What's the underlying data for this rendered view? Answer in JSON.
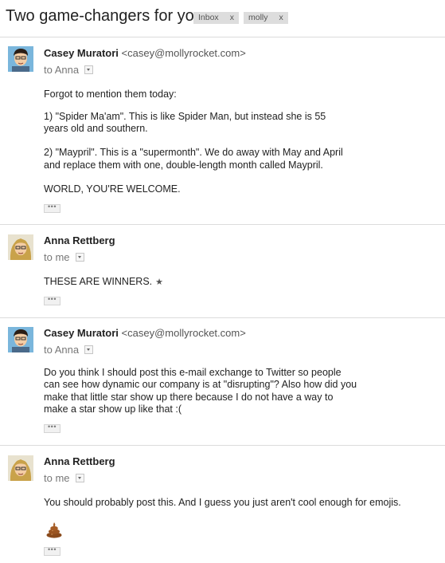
{
  "thread": {
    "subject": "Two game-changers for you.",
    "labels": [
      {
        "name": "Inbox",
        "remove": "x"
      },
      {
        "name": "molly",
        "remove": "x"
      }
    ]
  },
  "messages": [
    {
      "sender": "Casey Muratori",
      "email": "<casey@mollyrocket.com>",
      "to": "to Anna",
      "lines": [
        "Forgot to mention them today:",
        "1) \"Spider Ma'am\".  This is like Spider Man, but instead she is 55",
        "years old and southern.",
        "2) \"Maypril\".  This is a \"supermonth\".  We do away with May and April",
        "and replace them with one, double-length month called Maypril.",
        "WORLD, YOU'RE WELCOME."
      ],
      "more": "•••"
    },
    {
      "sender": "Anna Rettberg",
      "to": "to me",
      "lines": [
        "THESE ARE WINNERS."
      ],
      "star": "★",
      "more": "•••"
    },
    {
      "sender": "Casey Muratori",
      "email": "<casey@mollyrocket.com>",
      "to": "to Anna",
      "lines": [
        "Do you think I should post this e-mail exchange to Twitter so people",
        "can see how dynamic our company is at \"disrupting\"?  Also how did you",
        "make that little star show up there because I do not have a way to",
        "make a star show up like that :("
      ],
      "more": "•••"
    },
    {
      "sender": "Anna Rettberg",
      "to": "to me",
      "lines": [
        "You should probably post this. And I guess you just aren't cool enough for emojis."
      ],
      "emoji": "poo-emoji",
      "more": "•••"
    }
  ],
  "colors": {
    "label_bg": "#dddddd",
    "divider": "#dcdcdc"
  }
}
